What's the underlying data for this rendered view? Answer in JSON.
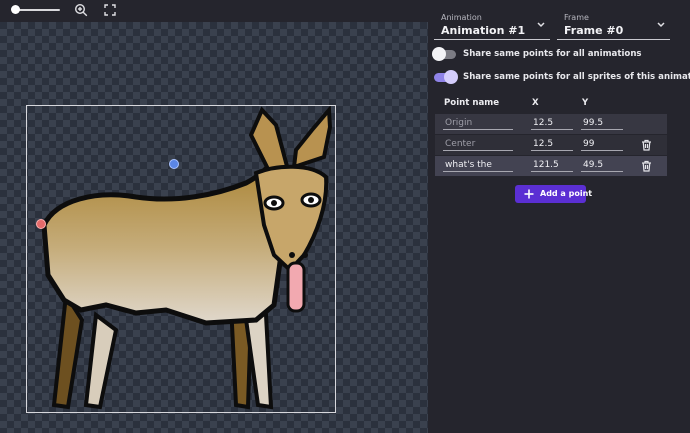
{
  "toolbar": {
    "zoom_slider_level": 0.0,
    "zoom_icon": "zoom-in-icon",
    "fit_icon": "fit-to-screen-icon"
  },
  "editor": {
    "animation_select": {
      "label": "Animation",
      "value": "Animation #1"
    },
    "frame_select": {
      "label": "Frame",
      "value": "Frame #0"
    },
    "toggles": [
      {
        "label": "Share same points for all animations",
        "on": false
      },
      {
        "label": "Share same points for all sprites of this animation",
        "on": true
      }
    ],
    "table": {
      "headers": {
        "name": "Point name",
        "x": "X",
        "y": "Y"
      },
      "rows": [
        {
          "name": "Origin",
          "x": "12.5",
          "y": "99.5",
          "deletable": false
        },
        {
          "name": "Center",
          "x": "12.5",
          "y": "99",
          "deletable": true
        },
        {
          "name": "what's the",
          "x": "121.5",
          "y": "49.5",
          "deletable": true
        }
      ]
    },
    "add_point_label": "Add a point"
  },
  "colors": {
    "accent": "#5b2fd3",
    "toggle_on": "#8f83e8",
    "center_marker": "#5b86e5",
    "origin_marker": "#e46a6a"
  }
}
